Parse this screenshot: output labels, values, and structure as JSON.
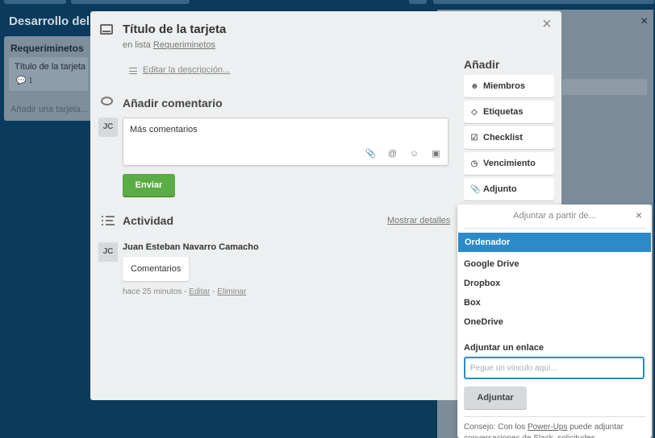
{
  "board": {
    "title": "Desarrollo del",
    "list": {
      "title": "Requeriminetos",
      "card_title": "Título de la tarjeta",
      "card_badge": "1",
      "add_card": "Añadir una tarjeta..."
    }
  },
  "card": {
    "title": "Título de la tarjeta",
    "in_list_prefix": "en lista",
    "list_name": "Requeriminetos",
    "edit_description": "Editar la descripción...",
    "close_label": "×"
  },
  "comment": {
    "section_title": "Añadir comentario",
    "avatar": "JC",
    "text": "Más comentarios",
    "send_label": "Enviar"
  },
  "activity": {
    "section_title": "Actividad",
    "show_details": "Mostrar detalles",
    "user": "Juan Esteban Navarro Camacho",
    "avatar": "JC",
    "comment": "Comentarios",
    "time": "hace 25 minutos",
    "edit": "Editar",
    "delete": "Eliminar"
  },
  "sidebar": {
    "title": "Añadir",
    "buttons": [
      {
        "label": "Miembros",
        "icon": "person-icon"
      },
      {
        "label": "Etiquetas",
        "icon": "tag-icon"
      },
      {
        "label": "Checklist",
        "icon": "checkbox-icon"
      },
      {
        "label": "Vencimiento",
        "icon": "clock-icon"
      },
      {
        "label": "Adjunto",
        "icon": "paperclip-icon"
      }
    ]
  },
  "attach_popover": {
    "title": "Adjuntar a partir de...",
    "close_label": "×",
    "sources": [
      "Ordenador",
      "Google Drive",
      "Dropbox",
      "Box",
      "OneDrive"
    ],
    "selected": "Ordenador",
    "link_label": "Adjuntar un enlace",
    "link_placeholder": "Pegue un vínculo aquí...",
    "attach_button": "Adjuntar",
    "tip_prefix": "Consejo: Con los",
    "tip_link": "Power-Ups",
    "tip_suffix": "puede adjuntar conversaciones de Slack, solicitudes..."
  },
  "colors": {
    "accent": "#2a8bc8",
    "send_button": "#5aac44",
    "board_bg": "#0a3a5c"
  }
}
